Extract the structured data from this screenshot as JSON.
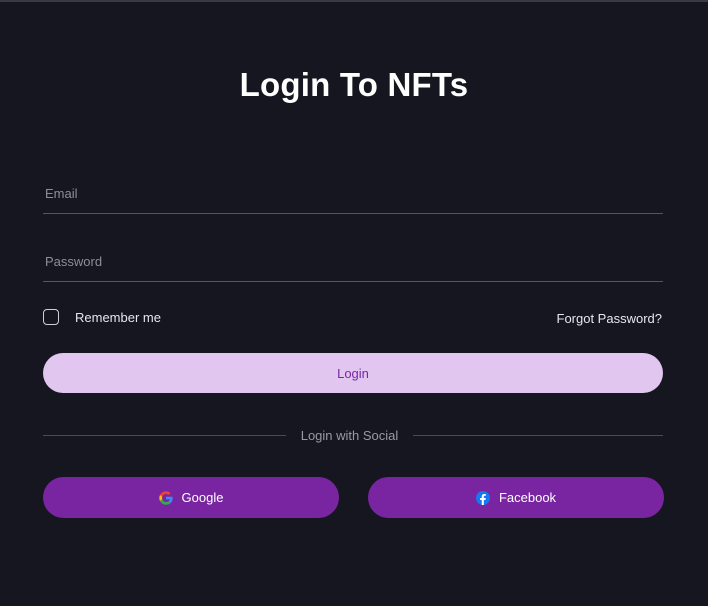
{
  "header": {
    "title": "Login To NFTs"
  },
  "form": {
    "email_placeholder": "Email",
    "password_placeholder": "Password",
    "remember_label": "Remember me",
    "remember_checked": false,
    "forgot_label": "Forgot Password?",
    "login_label": "Login"
  },
  "social": {
    "divider_label": "Login with Social",
    "google_label": "Google",
    "google_icon": "google-icon",
    "facebook_label": "Facebook",
    "facebook_icon": "facebook-icon"
  },
  "colors": {
    "background": "#161620",
    "login_button": "#e1c6f0",
    "login_text": "#7a26a4",
    "social_button": "#7925a1"
  }
}
